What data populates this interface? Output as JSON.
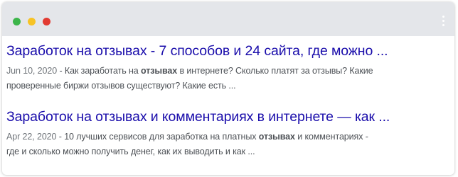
{
  "window": {
    "traffic_lights": [
      "green",
      "yellow",
      "red"
    ],
    "menu_icon": "kebab-menu-icon",
    "colors": {
      "titlebar": "#e4e6ea",
      "link": "#1a0dab",
      "snippet": "#4d5156",
      "date": "#70757a"
    }
  },
  "results": [
    {
      "title": "Заработок на отзывах - 7 способов и 24 сайта, где можно ...",
      "date": "Jun 10, 2020",
      "separator": " - ",
      "snippet_pre": "Как заработать на ",
      "snippet_bold": "отзывах",
      "snippet_post1": " в интернете? Сколько платят за отзывы? Какие",
      "snippet_line2": "проверенные биржи отзывов существуют? Какие есть ..."
    },
    {
      "title": "Заработок на отзывах и комментариях в интернете — как ...",
      "date": "Apr 22, 2020",
      "separator": " - ",
      "snippet_pre": "10 лучших сервисов для заработка на платных ",
      "snippet_bold": "отзывах",
      "snippet_post1": " и комментариях -",
      "snippet_line2": "где и сколько можно получить денег, как их выводить и как ..."
    }
  ]
}
